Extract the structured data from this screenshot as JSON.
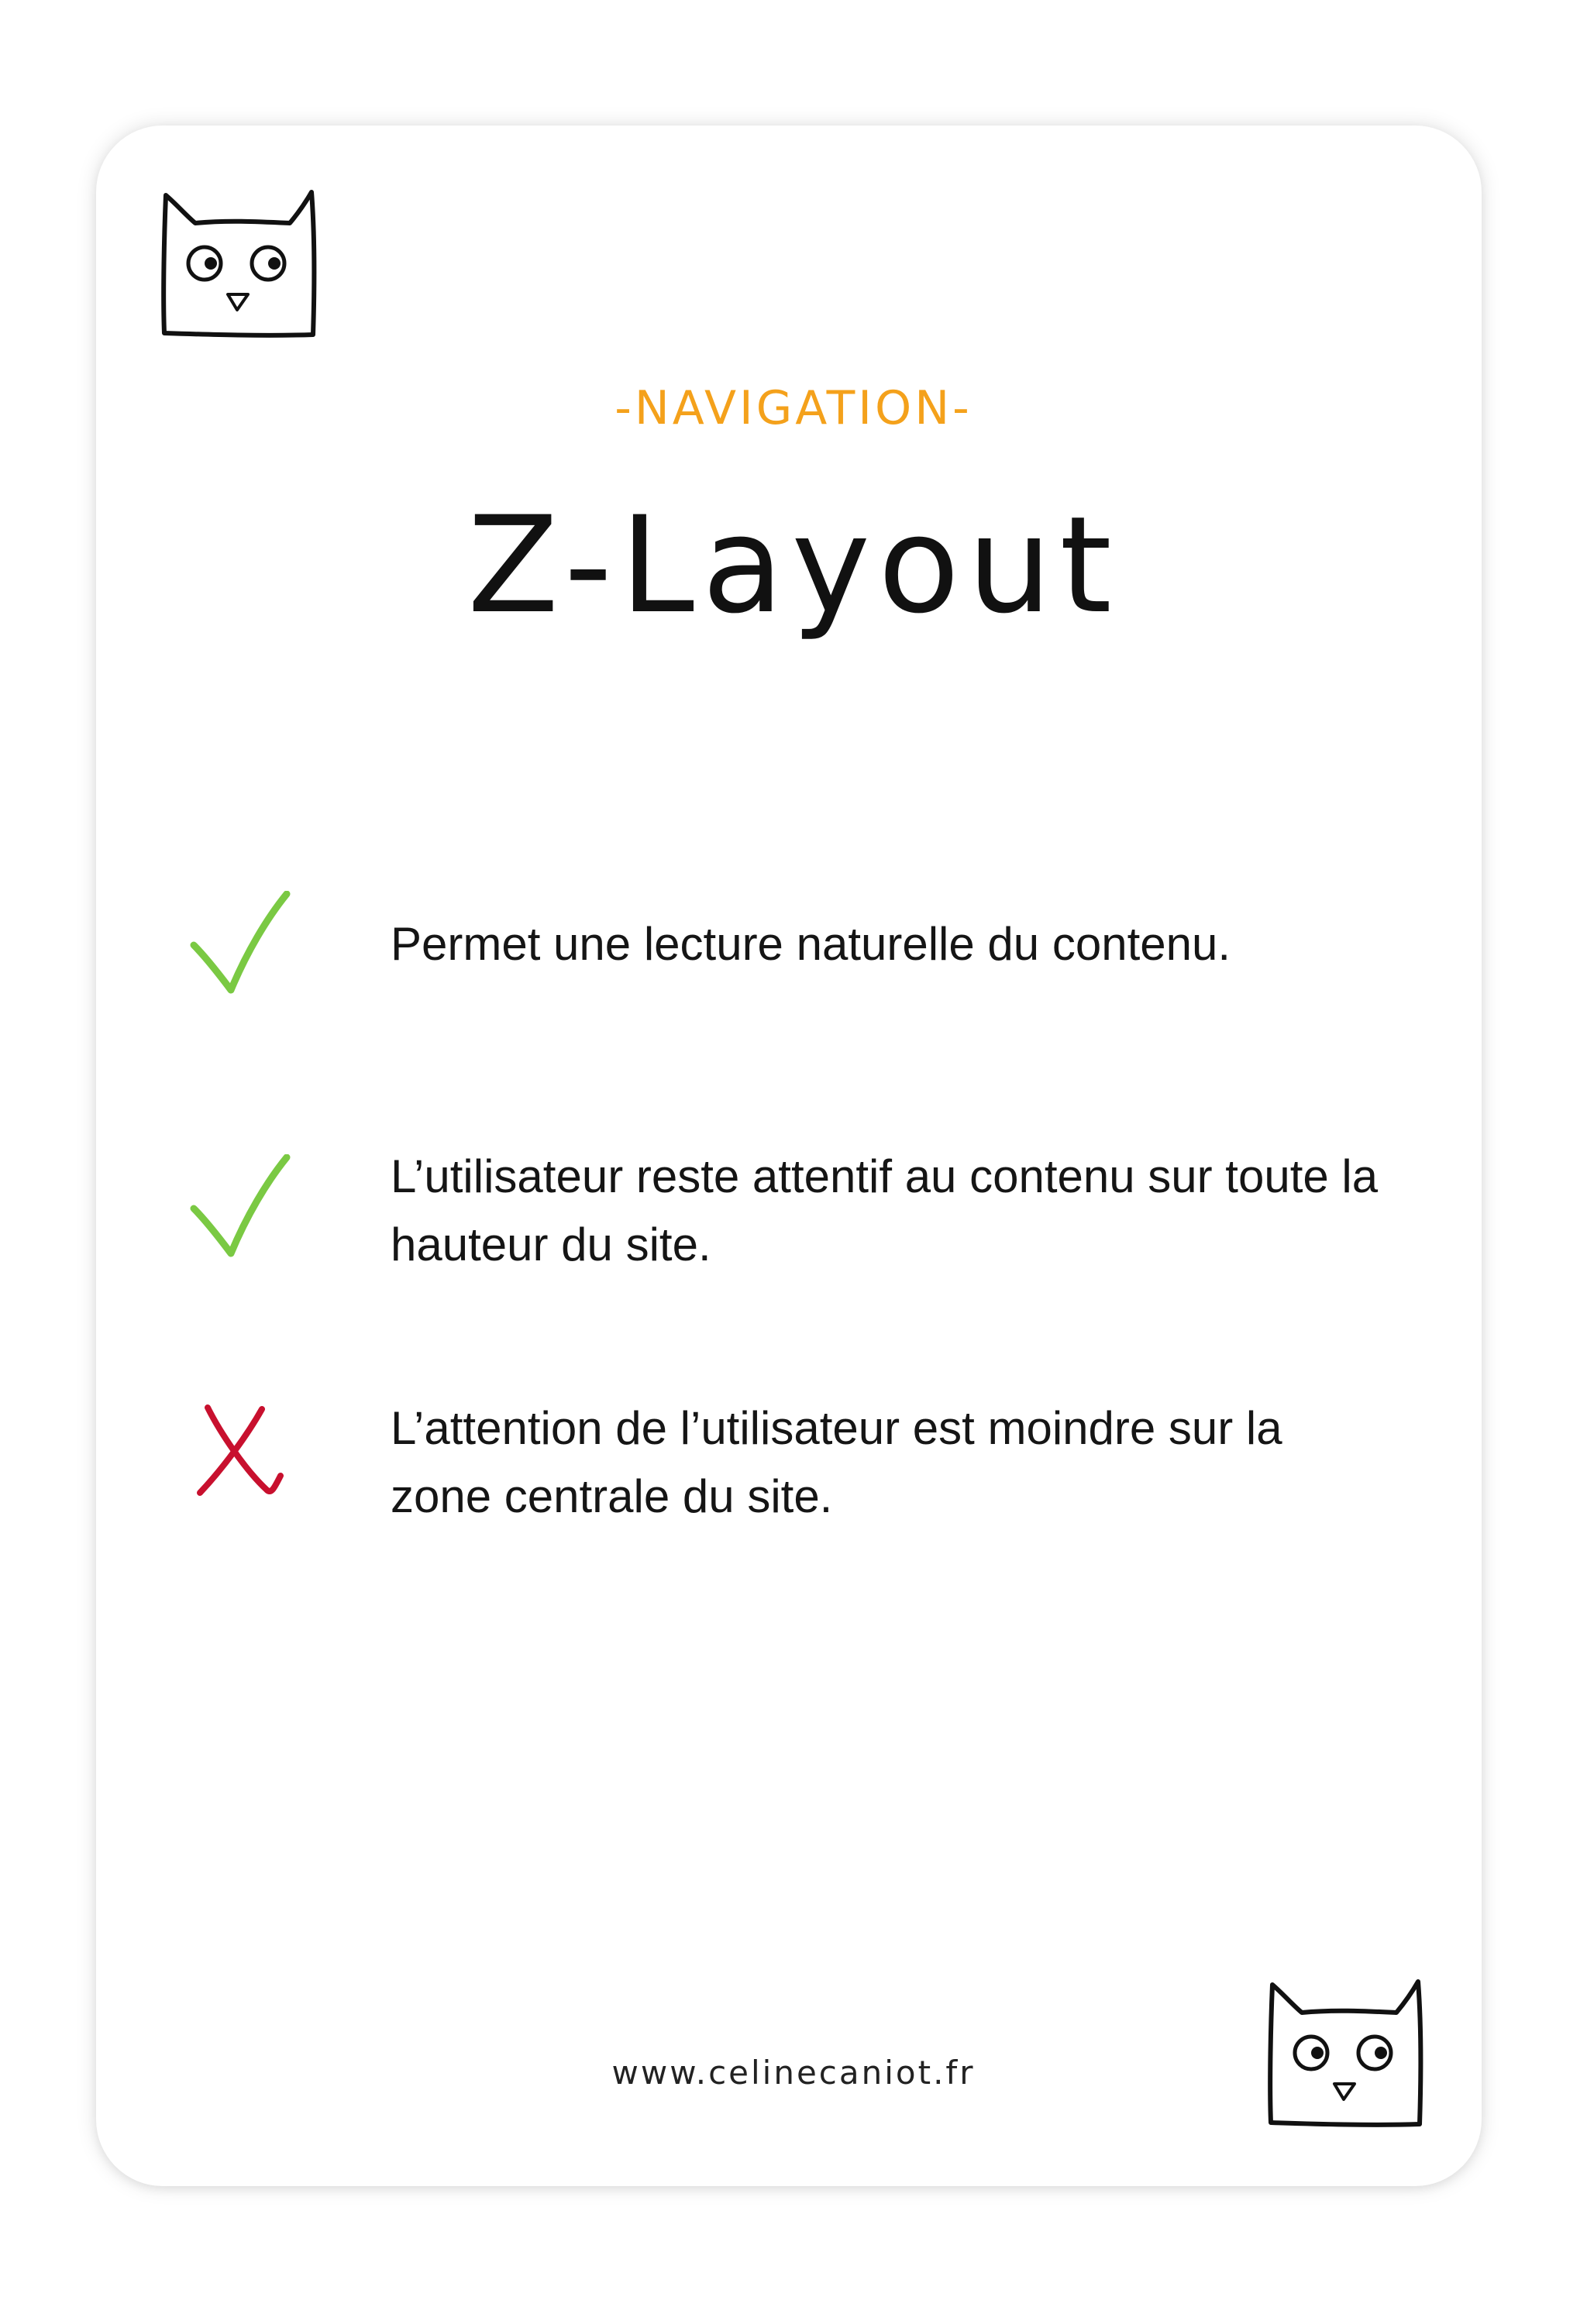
{
  "header": {
    "category": "-NAVIGATION-",
    "title": "Z-Layout"
  },
  "items": [
    {
      "icon": "check-icon",
      "status": "pro",
      "text": "Permet une lecture naturelle du contenu."
    },
    {
      "icon": "check-icon",
      "status": "pro",
      "text": "L’utilisateur reste attentif au contenu sur toute la hauteur du site."
    },
    {
      "icon": "cross-icon",
      "status": "con",
      "text": "L’attention de l’utilisateur est moindre sur la zone centrale du site."
    }
  ],
  "footer": {
    "url": "www.celinecaniot.fr"
  },
  "colors": {
    "accent": "#f4a11b",
    "check": "#7ac943",
    "cross": "#c8102e",
    "text": "#151515"
  }
}
